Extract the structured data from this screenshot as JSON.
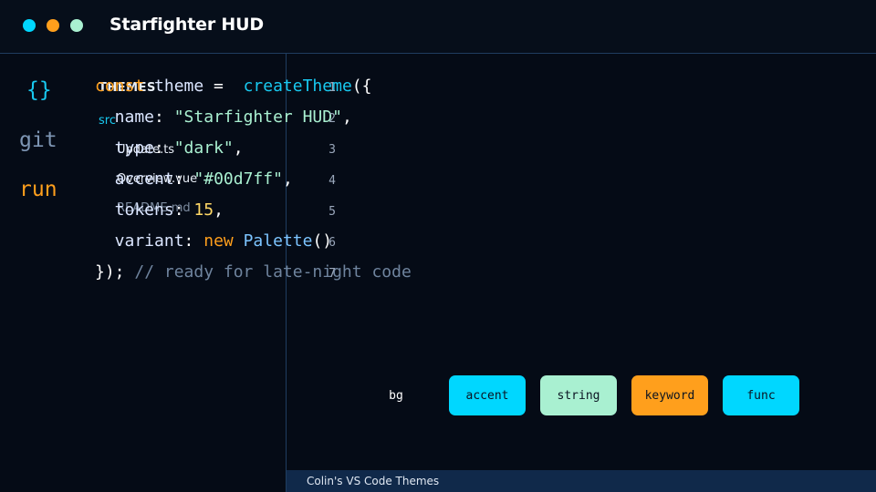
{
  "window": {
    "title": "Starfighter HUD",
    "controls": [
      {
        "name": "cyan-dot",
        "color": "#00d7ff"
      },
      {
        "name": "orange-dot",
        "color": "#ff9f1c"
      },
      {
        "name": "mint-dot",
        "color": "#a9f0d1"
      }
    ]
  },
  "activity_bar": {
    "items": [
      {
        "label": "{}",
        "color": "#18c9f0"
      },
      {
        "label": "git",
        "color": "#7d95b3"
      },
      {
        "label": "run",
        "color": "#ff9f1c"
      }
    ]
  },
  "explorer": {
    "header": "THEMES",
    "folder": "src",
    "files": [
      "Update.ts",
      "Overview.vue",
      "README.md"
    ]
  },
  "editor": {
    "line_numbers": [
      "1",
      "2",
      "3",
      "4",
      "5",
      "6",
      "7"
    ],
    "lines": [
      [
        {
          "t": "const",
          "c": "kw"
        },
        {
          "t": " theme ",
          "c": "prop"
        },
        {
          "t": "=",
          "c": "punc"
        },
        {
          "t": "  ",
          "c": "punc"
        },
        {
          "t": "createTheme",
          "c": "fn"
        },
        {
          "t": "({",
          "c": "punc"
        }
      ],
      [
        {
          "t": "  name",
          "c": "prop"
        },
        {
          "t": ": ",
          "c": "punc"
        },
        {
          "t": "\"Starfighter HUD\"",
          "c": "str"
        },
        {
          "t": ",",
          "c": "punc"
        }
      ],
      [
        {
          "t": "  type",
          "c": "prop"
        },
        {
          "t": ": ",
          "c": "punc"
        },
        {
          "t": "\"dark\"",
          "c": "str"
        },
        {
          "t": ",",
          "c": "punc"
        }
      ],
      [
        {
          "t": "  accent",
          "c": "prop"
        },
        {
          "t": ": ",
          "c": "punc"
        },
        {
          "t": "\"#00d7ff\"",
          "c": "str"
        },
        {
          "t": ",",
          "c": "punc"
        }
      ],
      [
        {
          "t": "  tokens",
          "c": "prop"
        },
        {
          "t": ": ",
          "c": "punc"
        },
        {
          "t": "15",
          "c": "num"
        },
        {
          "t": ",",
          "c": "punc"
        }
      ],
      [
        {
          "t": "  variant",
          "c": "prop"
        },
        {
          "t": ": ",
          "c": "punc"
        },
        {
          "t": "new ",
          "c": "kw"
        },
        {
          "t": "Palette",
          "c": "cls"
        },
        {
          "t": "()",
          "c": "punc"
        }
      ],
      [
        {
          "t": "});",
          "c": "punc"
        },
        {
          "t": " // ready for late-night code",
          "c": "cmt"
        }
      ]
    ]
  },
  "palette": {
    "bg_label": "bg",
    "swatches": [
      {
        "label": "accent",
        "color": "#00d7ff"
      },
      {
        "label": "string",
        "color": "#a9f0d1"
      },
      {
        "label": "keyword",
        "color": "#ff9f1c"
      },
      {
        "label": "func",
        "color": "#00d7ff"
      }
    ]
  },
  "statusbar": {
    "text": "Colin's VS Code Themes"
  }
}
